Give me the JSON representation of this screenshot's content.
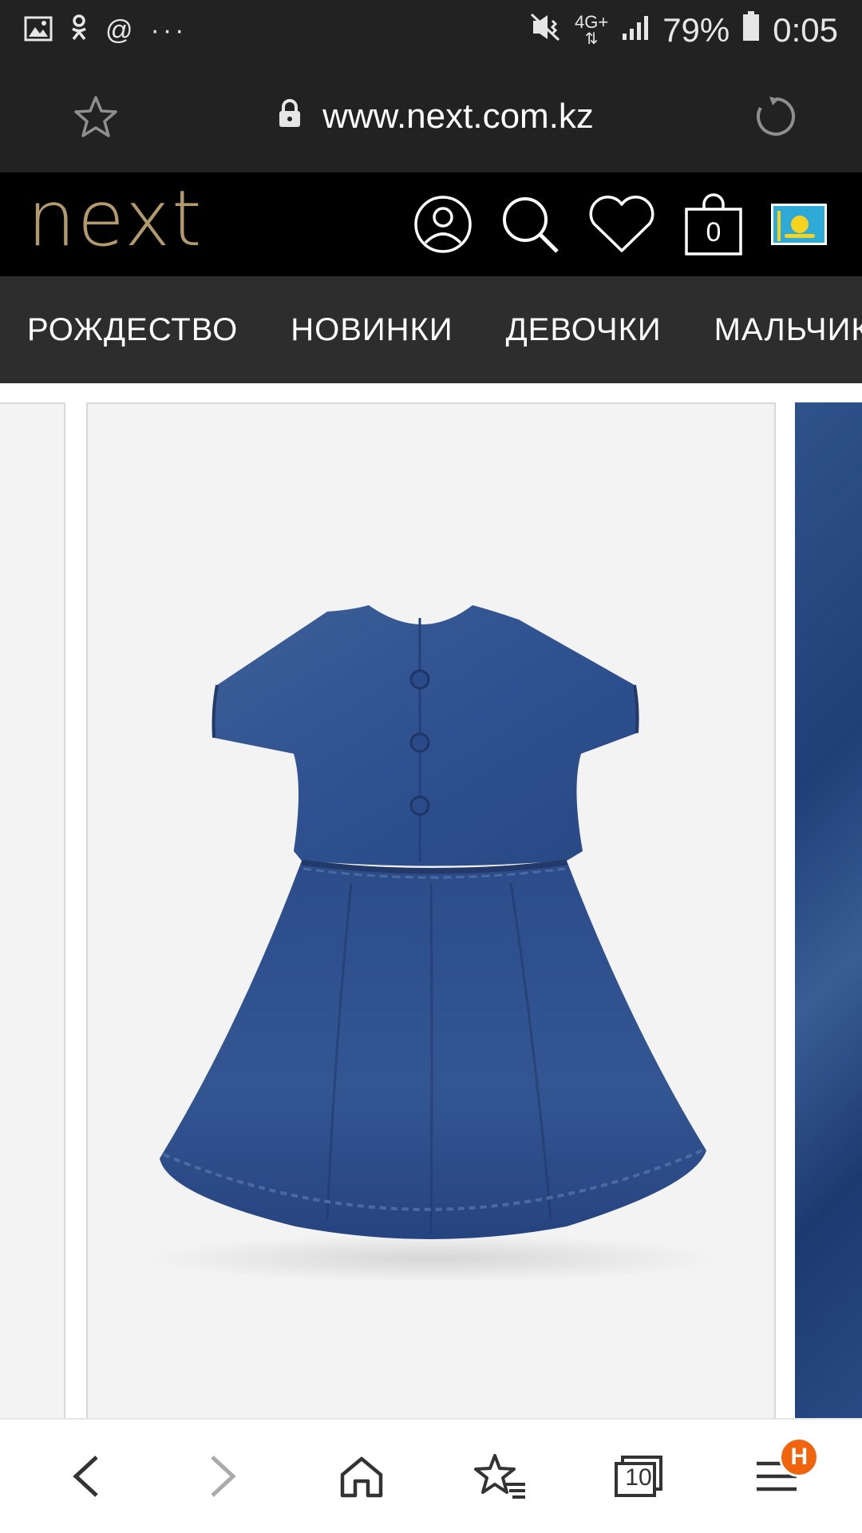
{
  "status_bar": {
    "left_icons": [
      "image-icon",
      "odnoklassniki-icon",
      "at-icon",
      "more-dots-icon"
    ],
    "network_type": "4G+",
    "battery": "79%",
    "time": "0:05"
  },
  "browser": {
    "url": "www.next.com.kz",
    "tabs_count": "10",
    "menu_badge": "H"
  },
  "site_header": {
    "logo": "next",
    "bag_count": "0",
    "colors": {
      "logo": "#b39a6d",
      "header_bg": "#000000",
      "nav_bg": "#2d2d2d"
    }
  },
  "nav": {
    "items": [
      "РОЖДЕСТВО",
      "НОВИНКИ",
      "ДЕВОЧКИ",
      "МАЛЬЧИКИ"
    ]
  },
  "product": {
    "image": "denim-dress-back-view"
  }
}
